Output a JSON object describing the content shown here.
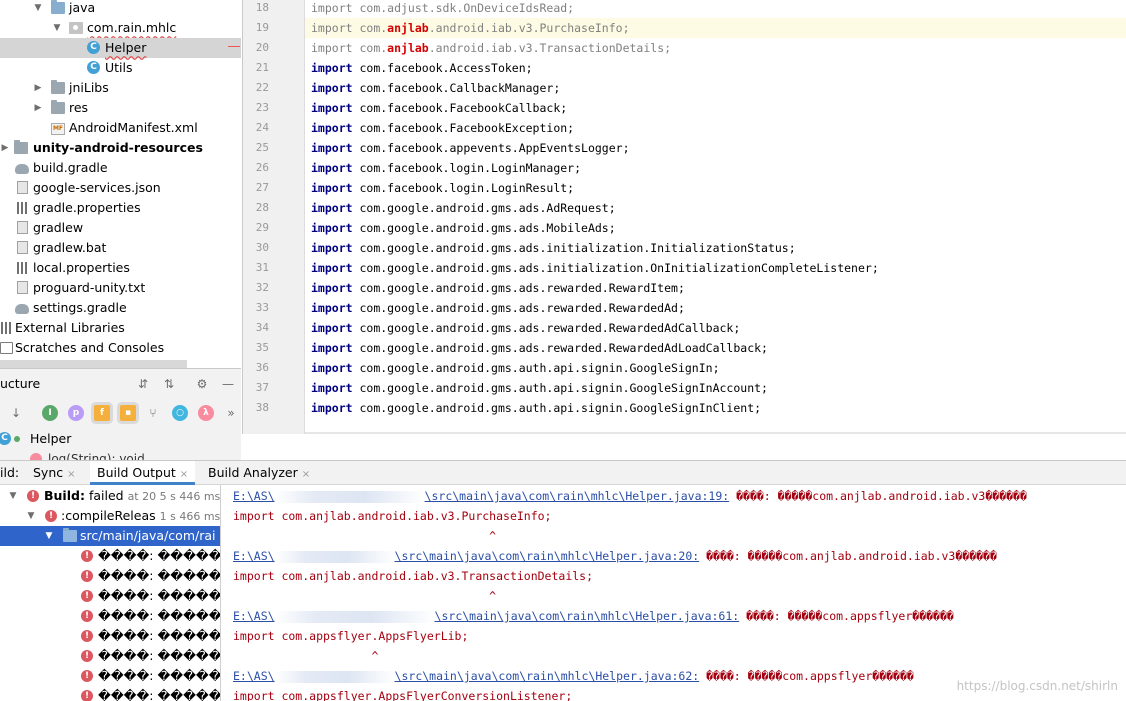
{
  "project_tree": {
    "items": [
      {
        "label": "java"
      },
      {
        "label": "com.rain.mhlc"
      },
      {
        "label": "Helper",
        "icon_letter": "C"
      },
      {
        "label": "Utils",
        "icon_letter": "C"
      },
      {
        "label": "jniLibs"
      },
      {
        "label": "res"
      },
      {
        "label": "AndroidManifest.xml",
        "icon_text": "MF"
      },
      {
        "label": "unity-android-resources"
      },
      {
        "label": "build.gradle"
      },
      {
        "label": "google-services.json"
      },
      {
        "label": "gradle.properties"
      },
      {
        "label": "gradlew"
      },
      {
        "label": "gradlew.bat"
      },
      {
        "label": "local.properties"
      },
      {
        "label": "proguard-unity.txt"
      },
      {
        "label": "settings.gradle"
      },
      {
        "label": "External Libraries"
      },
      {
        "label": "Scratches and Consoles"
      }
    ]
  },
  "editor": {
    "lines": [
      {
        "num": "18",
        "kw": "import",
        "pre": " com.adjust.sdk.OnDeviceIdsRead;",
        "red": "",
        "post": "",
        "dim": true
      },
      {
        "num": "19",
        "kw": "import",
        "pre": " com.",
        "red": "anjlab",
        "post": ".android.iab.v3.PurchaseInfo;",
        "dim": true
      },
      {
        "num": "20",
        "kw": "import",
        "pre": " com.",
        "red": "anjlab",
        "post": ".android.iab.v3.TransactionDetails;",
        "dim": true
      },
      {
        "num": "21",
        "kw": "import",
        "pre": " com.facebook.AccessToken;",
        "red": "",
        "post": "",
        "dim": false
      },
      {
        "num": "22",
        "kw": "import",
        "pre": " com.facebook.CallbackManager;",
        "red": "",
        "post": "",
        "dim": false
      },
      {
        "num": "23",
        "kw": "import",
        "pre": " com.facebook.FacebookCallback;",
        "red": "",
        "post": "",
        "dim": false
      },
      {
        "num": "24",
        "kw": "import",
        "pre": " com.facebook.FacebookException;",
        "red": "",
        "post": "",
        "dim": false
      },
      {
        "num": "25",
        "kw": "import",
        "pre": " com.facebook.appevents.AppEventsLogger;",
        "red": "",
        "post": "",
        "dim": false
      },
      {
        "num": "26",
        "kw": "import",
        "pre": " com.facebook.login.LoginManager;",
        "red": "",
        "post": "",
        "dim": false
      },
      {
        "num": "27",
        "kw": "import",
        "pre": " com.facebook.login.LoginResult;",
        "red": "",
        "post": "",
        "dim": false
      },
      {
        "num": "28",
        "kw": "import",
        "pre": " com.google.android.gms.ads.AdRequest;",
        "red": "",
        "post": "",
        "dim": false
      },
      {
        "num": "29",
        "kw": "import",
        "pre": " com.google.android.gms.ads.MobileAds;",
        "red": "",
        "post": "",
        "dim": false
      },
      {
        "num": "30",
        "kw": "import",
        "pre": " com.google.android.gms.ads.initialization.InitializationStatus;",
        "red": "",
        "post": "",
        "dim": false
      },
      {
        "num": "31",
        "kw": "import",
        "pre": " com.google.android.gms.ads.initialization.OnInitializationCompleteListener;",
        "red": "",
        "post": "",
        "dim": false
      },
      {
        "num": "32",
        "kw": "import",
        "pre": " com.google.android.gms.ads.rewarded.RewardItem;",
        "red": "",
        "post": "",
        "dim": false
      },
      {
        "num": "33",
        "kw": "import",
        "pre": " com.google.android.gms.ads.rewarded.RewardedAd;",
        "red": "",
        "post": "",
        "dim": false
      },
      {
        "num": "34",
        "kw": "import",
        "pre": " com.google.android.gms.ads.rewarded.RewardedAdCallback;",
        "red": "",
        "post": "",
        "dim": false
      },
      {
        "num": "35",
        "kw": "import",
        "pre": " com.google.android.gms.ads.rewarded.RewardedAdLoadCallback;",
        "red": "",
        "post": "",
        "dim": false
      },
      {
        "num": "36",
        "kw": "import",
        "pre": " com.google.android.gms.auth.api.signin.GoogleSignIn;",
        "red": "",
        "post": "",
        "dim": false
      },
      {
        "num": "37",
        "kw": "import",
        "pre": " com.google.android.gms.auth.api.signin.GoogleSignInAccount;",
        "red": "",
        "post": "",
        "dim": false
      },
      {
        "num": "38",
        "kw": "import",
        "pre": " com.google.android.gms.auth.api.signin.GoogleSignInClient;",
        "red": "",
        "post": "",
        "dim": false
      }
    ]
  },
  "structure": {
    "title": "ucture",
    "toolbar_letters": [
      "I",
      "p",
      "f",
      "λ"
    ],
    "row_class": "Helper",
    "row_class_letter": "C",
    "row_method": "log(String): void"
  },
  "build_tabs": {
    "prefix": "ild:",
    "sync": "Sync",
    "build_output": "Build Output",
    "build_analyzer": "Build Analyzer",
    "close_glyph": "×"
  },
  "build_tree": {
    "root_label": "Build:",
    "root_status": "failed",
    "root_time": "at 20 5 s 446 ms",
    "task_label": ":compileReleas",
    "task_time": "1 s 466 ms",
    "file_label": "src/main/java/com/rai",
    "error_label": "����: �����"
  },
  "build_output": {
    "lines": [
      {
        "link_pre": "E:\\AS\\",
        "link_post": "\\src\\main\\java\\com\\rain\\mhlc\\Helper.java:19:",
        "msg": " ����: �����com.anjlab.android.iab.v3������"
      },
      {
        "text": "import com.anjlab.android.iab.v3.PurchaseInfo;"
      },
      {
        "text": "                                     ^"
      },
      {
        "link_pre": "E:\\AS\\",
        "link_post": "\\src\\main\\java\\com\\rain\\mhlc\\Helper.java:20:",
        "msg": " ����: �����com.anjlab.android.iab.v3������"
      },
      {
        "text": "import com.anjlab.android.iab.v3.TransactionDetails;"
      },
      {
        "text": "                                     ^"
      },
      {
        "link_pre": "E:\\AS\\",
        "link_post": "\\src\\main\\java\\com\\rain\\mhlc\\Helper.java:61:",
        "msg": " ����: �����com.appsflyer������"
      },
      {
        "text": "import com.appsflyer.AppsFlyerLib;"
      },
      {
        "text": "                    ^"
      },
      {
        "link_pre": "E:\\AS\\",
        "link_post": "\\src\\main\\java\\com\\rain\\mhlc\\Helper.java:62:",
        "msg": " ����: �����com.appsflyer������"
      },
      {
        "text": "import com.appsflyer.AppsFlyerConversionListener;"
      }
    ],
    "watermark": "https://blog.csdn.net/shirln"
  },
  "colors": {
    "accent": "#2f65ca",
    "error": "#db5860",
    "link": "#2a4ea6",
    "keyword": "#000080"
  }
}
